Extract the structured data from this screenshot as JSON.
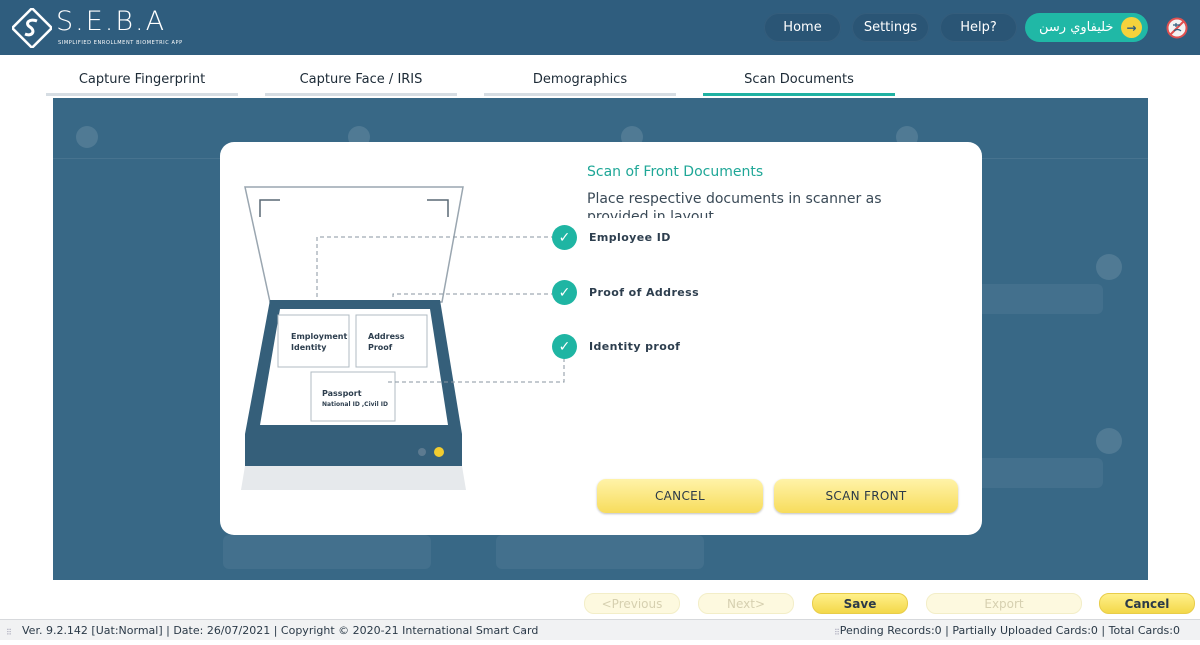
{
  "app": {
    "logo_text": "S.E.B.A",
    "logo_subtitle": "SIMPLIFIED ENROLLMENT BIOMETRIC APP"
  },
  "header": {
    "home_label": "Home",
    "settings_label": "Settings",
    "help_label": "Help?",
    "user_name": "خليفاوي رسن",
    "arrow_glyph": "→"
  },
  "tabs": [
    {
      "label": "Capture Fingerprint"
    },
    {
      "label": "Capture Face / IRIS"
    },
    {
      "label": "Demographics"
    },
    {
      "label": "Scan Documents",
      "active": true
    }
  ],
  "modal": {
    "title": "Scan of Front Documents",
    "subtitle": "Place respective documents in scanner as provided in layout",
    "check_glyph": "✓",
    "items": [
      {
        "label": "Employee ID"
      },
      {
        "label": "Proof of Address"
      },
      {
        "label": "Identity proof"
      }
    ],
    "scanner": {
      "doc_employment": "Employment Identity",
      "doc_employment_l1": "Employment",
      "doc_employment_l2": "Identity",
      "doc_address_l1": "Address",
      "doc_address_l2": "Proof",
      "doc_passport_l1": "Passport",
      "doc_passport_l2": "National ID ,Civil ID"
    },
    "cancel_label": "CANCEL",
    "scan_label": "SCAN FRONT"
  },
  "footer_buttons": {
    "previous": "<Previous",
    "next": "Next>",
    "save": "Save",
    "export": "Export",
    "cancel": "Cancel"
  },
  "status": {
    "left": "Ver. 9.2.142 [Uat:Normal] | Date: 26/07/2021 | Copyright © 2020-21 International Smart Card",
    "right": "Pending Records:0 | Partially Uploaded Cards:0 | Total Cards:0"
  },
  "colors": {
    "header": "#2f5d7e",
    "accent": "#20b2a3",
    "button_yellow": "#f7dc5c"
  }
}
